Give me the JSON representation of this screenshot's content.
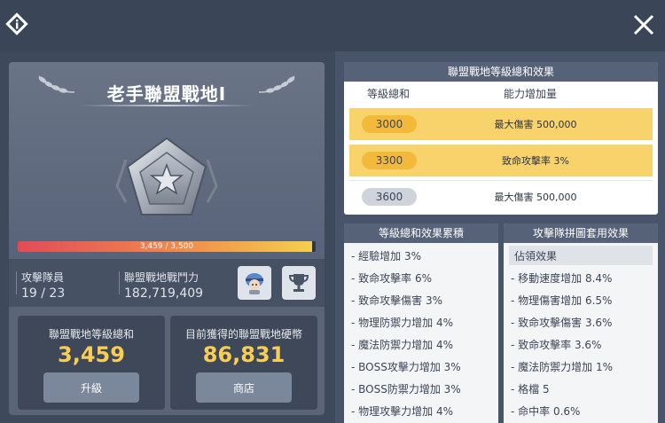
{
  "header": {
    "info_icon": "info-diamond-icon",
    "close_icon": "close-icon"
  },
  "left": {
    "title": "老手聯盟戰地I",
    "progress": {
      "text": "3,459 / 3,500",
      "current": 3459,
      "max": 3500
    },
    "members_label": "攻擊隊員",
    "members_value": "19 / 23",
    "power_label": "聯盟戰地戰鬥力",
    "power_value": "182,719,409",
    "card1": {
      "label": "聯盟戰地等級總和",
      "value": "3,459",
      "button": "升級"
    },
    "card2": {
      "label": "目前獲得的聯盟戰地硬幣",
      "value": "86,831",
      "button": "商店"
    }
  },
  "level_effects": {
    "title": "聯盟戰地等級總和效果",
    "col1": "等級總和",
    "col2": "能力增加量",
    "rows": [
      {
        "level": "3000",
        "effect": "最大傷害 500,000"
      },
      {
        "level": "3300",
        "effect": "致命攻擊率 3%"
      },
      {
        "level": "3600",
        "effect": "最大傷害 500,000"
      }
    ]
  },
  "cumulative": {
    "title": "等級總和效果累積",
    "items": [
      "- 經驗增加 3%",
      "- 致命攻擊率 6%",
      "- 致命攻擊傷害 3%",
      "- 物理防禦力增加 4%",
      "- 魔法防禦力增加 4%",
      "- BOSS攻擊力增加 3%",
      "- BOSS防禦力增加 3%",
      "- 物理攻擊力增加 4%"
    ]
  },
  "puzzle": {
    "title": "攻擊隊拼圖套用效果",
    "subtitle": "佔領效果",
    "items": [
      "- 移動速度增加 8.4%",
      "- 物理傷害增加 6.5%",
      "- 致命攻擊傷害 3.6%",
      "- 致命攻擊率 3.6%",
      "- 魔法防禦力增加 1%",
      "- 格檔 5",
      "- 命中率 0.6%"
    ]
  }
}
